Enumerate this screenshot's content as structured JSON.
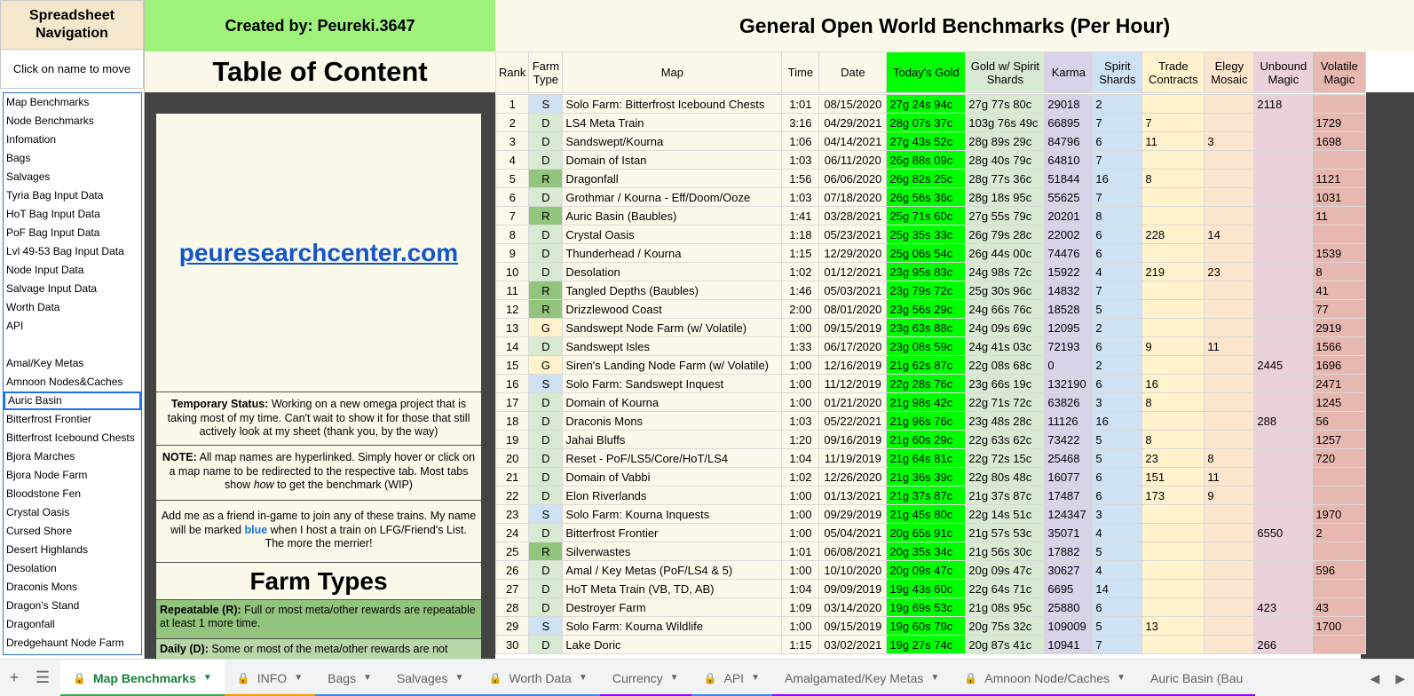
{
  "nav": {
    "title": "Spreadsheet Navigation",
    "hint": "Click on name to move",
    "items": [
      "Map Benchmarks",
      "Node Benchmarks",
      "Infomation",
      "Bags",
      "Salvages",
      "Tyria Bag Input Data",
      "HoT Bag Input Data",
      "PoF Bag Input Data",
      "Lvl 49-53 Bag Input Data",
      "Node Input Data",
      "Salvage Input Data",
      "Worth Data",
      "API",
      "",
      "Amal/Key Metas",
      "Amnoon Nodes&Caches",
      "Auric Basin",
      "Bitterfrost Frontier",
      "Bitterfrost Icebound Chests",
      "Bjora Marches",
      "Bjora Node Farm",
      "Bloodstone Fen",
      "Crystal Oasis",
      "Cursed Shore",
      "Desert Highlands",
      "Desolation",
      "Draconis Mons",
      "Dragon's Stand",
      "Dragonfall",
      "Dredgehaunt Node Farm"
    ],
    "selected_index": 16
  },
  "header": {
    "creator": "Created by: Peureki.3647",
    "toc": "Table of Content",
    "main_title": "General Open World Benchmarks (Per Hour)"
  },
  "left_panel": {
    "site": "peuresearchcenter.com",
    "status_label": "Temporary Status:",
    "status_text": "Working on a new omega project that is taking most of my time. Can't wait to show it for those that still actively look at my sheet (thank you, by the way)",
    "note_label": "NOTE:",
    "note_text_1": "All map names are hyperlinked. Simply hover or click on a map name to be redirected to the respective tab. Most tabs show",
    "note_how": "how",
    "note_text_2": "to get the benchmark (WIP)",
    "friend_1": "Add me as a friend in-game to join any of these trains. My name will be marked",
    "friend_blue": "blue",
    "friend_2": "when I host a train on LFG/Friend's List. The more the merrier!",
    "farm_types_title": "Farm Types",
    "repeatable_label": "Repeatable (R):",
    "repeatable_text": "Full or most meta/other rewards are repeatable at least 1 more time.",
    "daily_label": "Daily (D):",
    "daily_text": "Some or most of the meta/other rewards are not"
  },
  "table": {
    "headers": [
      "Rank",
      "Farm Type",
      "Map",
      "Time",
      "Date",
      "Today's Gold",
      "Gold w/ Spirit Shards",
      "Karma",
      "Spirit Shards",
      "Trade Contracts",
      "Elegy Mosaic",
      "Unbound Magic",
      "Volatile Magic"
    ],
    "colors": {
      "gold": "#00ff00",
      "gold_spirit": "#d9ead3",
      "karma": "#d9d2e9",
      "spirit": "#cfe2f3",
      "trade": "#fff2cc",
      "elegy": "#fce5cd",
      "unbound": "#ead1dc",
      "volatile": "#e6b8af",
      "type_S": "#cfe2f3",
      "type_D": "#d9ead3",
      "type_R": "#93c47d",
      "type_G": "#fff2cc",
      "base": "#fdf9ea"
    },
    "rows": [
      [
        "1",
        "S",
        "Solo Farm: Bitterfrost Icebound Chests",
        "1:01",
        "08/15/2020",
        "27g 24s 94c",
        "27g 77s 80c",
        "29018",
        "2",
        "",
        "",
        "2118",
        ""
      ],
      [
        "2",
        "D",
        "LS4 Meta Train",
        "3:16",
        "04/29/2021",
        "28g 07s 37c",
        "103g 76s 49c",
        "66895",
        "7",
        "7",
        "",
        "",
        "1729"
      ],
      [
        "3",
        "D",
        "Sandswept/Kourna",
        "1:06",
        "04/14/2021",
        "27g 43s 52c",
        "28g 89s 29c",
        "84796",
        "6",
        "11",
        "3",
        "",
        "1698"
      ],
      [
        "4",
        "D",
        "Domain of Istan",
        "1:03",
        "06/11/2020",
        "26g 88s 09c",
        "28g 40s 79c",
        "64810",
        "7",
        "",
        "",
        "",
        ""
      ],
      [
        "5",
        "R",
        "Dragonfall",
        "1:56",
        "06/06/2020",
        "26g 82s 25c",
        "28g 77s 36c",
        "51844",
        "16",
        "8",
        "",
        "",
        "1121"
      ],
      [
        "6",
        "D",
        "Grothmar / Kourna - Eff/Doom/Ooze",
        "1:03",
        "07/18/2020",
        "26g 56s 36c",
        "28g 18s 95c",
        "55625",
        "7",
        "",
        "",
        "",
        "1031"
      ],
      [
        "7",
        "R",
        "Auric Basin (Baubles)",
        "1:41",
        "03/28/2021",
        "25g 71s 60c",
        "27g 55s 79c",
        "20201",
        "8",
        "",
        "",
        "",
        "11"
      ],
      [
        "8",
        "D",
        "Crystal Oasis",
        "1:18",
        "05/23/2021",
        "25g 35s 33c",
        "26g 79s 28c",
        "22002",
        "6",
        "228",
        "14",
        "",
        ""
      ],
      [
        "9",
        "D",
        "Thunderhead / Kourna",
        "1:15",
        "12/29/2020",
        "25g 06s 54c",
        "26g 44s 00c",
        "74476",
        "6",
        "",
        "",
        "",
        "1539"
      ],
      [
        "10",
        "D",
        "Desolation",
        "1:02",
        "01/12/2021",
        "23g 95s 83c",
        "24g 98s 72c",
        "15922",
        "4",
        "219",
        "23",
        "",
        "8"
      ],
      [
        "11",
        "R",
        "Tangled Depths (Baubles)",
        "1:46",
        "05/03/2021",
        "23g 79s 72c",
        "25g 30s 96c",
        "14832",
        "7",
        "",
        "",
        "",
        "41"
      ],
      [
        "12",
        "R",
        "Drizzlewood Coast",
        "2:00",
        "08/01/2020",
        "23g 56s 29c",
        "24g 66s 76c",
        "18528",
        "5",
        "",
        "",
        "",
        "77"
      ],
      [
        "13",
        "G",
        "Sandswept Node Farm (w/ Volatile)",
        "1:00",
        "09/15/2019",
        "23g 63s 88c",
        "24g 09s 69c",
        "12095",
        "2",
        "",
        "",
        "",
        "2919"
      ],
      [
        "14",
        "D",
        "Sandswept Isles",
        "1:33",
        "06/17/2020",
        "23g 08s 59c",
        "24g 41s 03c",
        "72193",
        "6",
        "9",
        "11",
        "",
        "1566"
      ],
      [
        "15",
        "G",
        "Siren's Landing Node Farm (w/ Volatile)",
        "1:00",
        "12/16/2019",
        "21g 62s 87c",
        "22g 08s 68c",
        "0",
        "2",
        "",
        "",
        "2445",
        "1696"
      ],
      [
        "16",
        "S",
        "Solo Farm: Sandswept Inquest",
        "1:00",
        "11/12/2019",
        "22g 28s 76c",
        "23g 66s 19c",
        "132190",
        "6",
        "16",
        "",
        "",
        "2471"
      ],
      [
        "17",
        "D",
        "Domain of Kourna",
        "1:00",
        "01/21/2020",
        "21g 98s 42c",
        "22g 71s 72c",
        "63826",
        "3",
        "8",
        "",
        "",
        "1245"
      ],
      [
        "18",
        "D",
        "Draconis Mons",
        "1:03",
        "05/22/2021",
        "21g 96s 76c",
        "23g 48s 28c",
        "11126",
        "16",
        "",
        "",
        "288",
        "56"
      ],
      [
        "19",
        "D",
        "Jahai Bluffs",
        "1:20",
        "09/16/2019",
        "21g 60s 29c",
        "22g 63s 62c",
        "73422",
        "5",
        "8",
        "",
        "",
        "1257"
      ],
      [
        "20",
        "D",
        "Reset - PoF/LS5/Core/HoT/LS4",
        "1:04",
        "11/19/2019",
        "21g 64s 81c",
        "22g 72s 15c",
        "25468",
        "5",
        "23",
        "8",
        "",
        "720"
      ],
      [
        "21",
        "D",
        "Domain of Vabbi",
        "1:02",
        "12/26/2020",
        "21g 36s 39c",
        "22g 80s 48c",
        "16077",
        "6",
        "151",
        "11",
        "",
        ""
      ],
      [
        "22",
        "D",
        "Elon Riverlands",
        "1:00",
        "01/13/2021",
        "21g 37s 87c",
        "21g 37s 87c",
        "17487",
        "6",
        "173",
        "9",
        "",
        ""
      ],
      [
        "23",
        "S",
        "Solo Farm: Kourna Inquests",
        "1:00",
        "09/29/2019",
        "21g 45s 80c",
        "22g 14s 51c",
        "124347",
        "3",
        "",
        "",
        "",
        "1970"
      ],
      [
        "24",
        "D",
        "Bitterfrost Frontier",
        "1:00",
        "05/04/2021",
        "20g 65s 91c",
        "21g 57s 53c",
        "35071",
        "4",
        "",
        "",
        "6550",
        "2"
      ],
      [
        "25",
        "R",
        "Silverwastes",
        "1:01",
        "06/08/2021",
        "20g 35s 34c",
        "21g 56s 30c",
        "17882",
        "5",
        "",
        "",
        "",
        ""
      ],
      [
        "26",
        "D",
        "Amal / Key Metas (PoF/LS4 & 5)",
        "1:00",
        "10/10/2020",
        "20g 09s 47c",
        "20g 09s 47c",
        "30627",
        "4",
        "",
        "",
        "",
        "596"
      ],
      [
        "27",
        "D",
        "HoT Meta Train (VB, TD, AB)",
        "1:04",
        "09/09/2019",
        "19g 43s 60c",
        "22g 64s 71c",
        "6695",
        "14",
        "",
        "",
        "",
        ""
      ],
      [
        "28",
        "D",
        "Destroyer Farm",
        "1:09",
        "03/14/2020",
        "19g 69s 53c",
        "21g 08s 95c",
        "25880",
        "6",
        "",
        "",
        "423",
        "43"
      ],
      [
        "29",
        "S",
        "Solo Farm: Kourna Wildlife",
        "1:00",
        "09/15/2019",
        "19g 60s 79c",
        "20g 75s 32c",
        "109009",
        "5",
        "13",
        "",
        "",
        "1700"
      ],
      [
        "30",
        "D",
        "Lake Doric",
        "1:15",
        "03/02/2021",
        "19g 27s 74c",
        "20g 87s 41c",
        "10941",
        "7",
        "",
        "",
        "266",
        ""
      ]
    ]
  },
  "tabs": [
    {
      "label": "Map Benchmarks",
      "locked": true,
      "color": "#34a853",
      "active": true
    },
    {
      "label": "INFO",
      "locked": true,
      "color": "#ff9900",
      "active": false
    },
    {
      "label": "Bags",
      "locked": false,
      "color": "#4285f4",
      "active": false
    },
    {
      "label": "Salvages",
      "locked": false,
      "color": "#4285f4",
      "active": false
    },
    {
      "label": "Worth Data",
      "locked": true,
      "color": "#4285f4",
      "active": false
    },
    {
      "label": "Currency",
      "locked": false,
      "color": "#9900ff",
      "active": false
    },
    {
      "label": "API",
      "locked": true,
      "color": "#4285f4",
      "active": false
    },
    {
      "label": "Amalgamated/Key Metas",
      "locked": false,
      "color": "#9900ff",
      "active": false
    },
    {
      "label": "Amnoon Node/Caches",
      "locked": true,
      "color": "#9900ff",
      "active": false
    },
    {
      "label": "Auric Basin (Bau",
      "locked": false,
      "color": "#9900ff",
      "active": false
    }
  ]
}
